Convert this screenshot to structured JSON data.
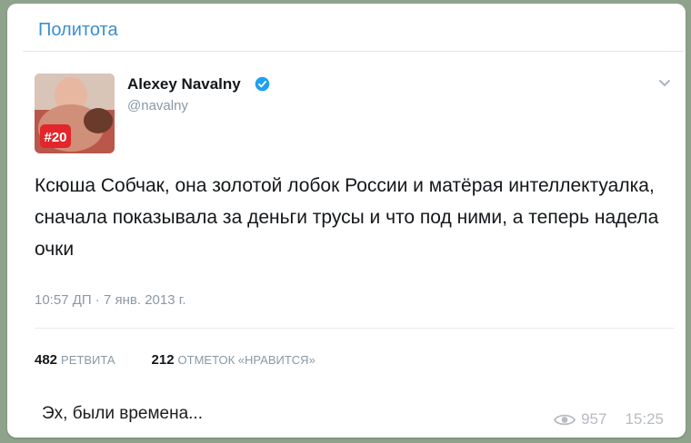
{
  "channel": {
    "title": "Политота"
  },
  "tweet": {
    "author_name": "Alexey Navalny",
    "handle": "@navalny",
    "verified_icon": "verified-badge-icon",
    "avatar_badge": "#20",
    "text": "Ксюша Собчак, она золотой лобок России и матёрая интеллектуалка, сначала показывала за деньги трусы и что под ними, а теперь надела очки",
    "timestamp": "10:57 ДП · 7 янв. 2013 г.",
    "retweets_count": "482",
    "retweets_label": "РЕТВИТА",
    "likes_count": "212",
    "likes_label": "ОТМЕТОК «НРАВИТСЯ»"
  },
  "message": {
    "caption": "Эх, были времена...",
    "views": "957",
    "time": "15:25"
  },
  "colors": {
    "channel_link": "#3a8fd0",
    "verified": "#1da1f2",
    "muted": "#8899a6",
    "background": "#8fa38c"
  }
}
